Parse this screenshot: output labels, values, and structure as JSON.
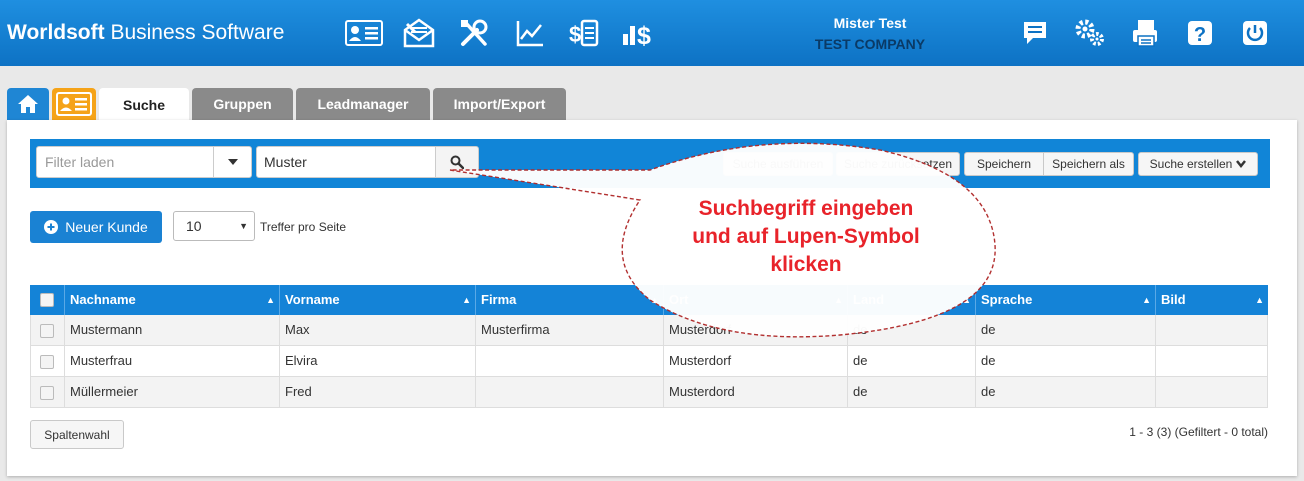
{
  "app": {
    "brand_bold": "Worldsoft",
    "brand_rest": "Business Software",
    "user_name": "Mister Test",
    "company": "TEST COMPANY",
    "nav_icons": [
      "contact-card-icon",
      "mail-campaign-icon",
      "tools-icon",
      "statistics-icon",
      "invoice-icon",
      "finance-icon"
    ],
    "right_icons": [
      "messages-icon",
      "settings-icon",
      "print-icon",
      "help-icon",
      "logout-icon"
    ]
  },
  "tabs": [
    {
      "label": "Suche",
      "active": true
    },
    {
      "label": "Gruppen",
      "active": false
    },
    {
      "label": "Leadmanager",
      "active": false
    },
    {
      "label": "Import/Export",
      "active": false
    }
  ],
  "search": {
    "filter_placeholder": "Filter laden",
    "query": "Muster"
  },
  "buttons": {
    "run": "Suche ausführen",
    "reset": "Suche zurücksetzen",
    "save": "Speichern",
    "save_as": "Speichern als",
    "create": "Suche erstellen",
    "new_customer": "Neuer Kunde",
    "columns": "Spaltenwahl"
  },
  "paging": {
    "per_page": "10",
    "per_page_label": "Treffer pro Seite",
    "summary": "1 - 3 (3) (Gefiltert - 0 total)"
  },
  "table": {
    "columns": [
      "Nachname",
      "Vorname",
      "Firma",
      "Ort",
      "Land",
      "Sprache",
      "Bild"
    ],
    "rows": [
      [
        "Mustermann",
        "Max",
        "Musterfirma",
        "Musterdorf",
        "de",
        "de",
        ""
      ],
      [
        "Musterfrau",
        "Elvira",
        "",
        "Musterdorf",
        "de",
        "de",
        ""
      ],
      [
        "Müllermeier",
        "Fred",
        "",
        "Musterdord",
        "de",
        "de",
        ""
      ]
    ]
  },
  "callout": {
    "line1": "Suchbegriff eingeben",
    "line2": "und auf Lupen-Symbol",
    "line3": "klicken",
    "color": "#e8232a"
  },
  "colors": {
    "primary": "#1185d7",
    "accent_orange": "#f5a318",
    "tab_inactive": "#8a8a8a"
  }
}
